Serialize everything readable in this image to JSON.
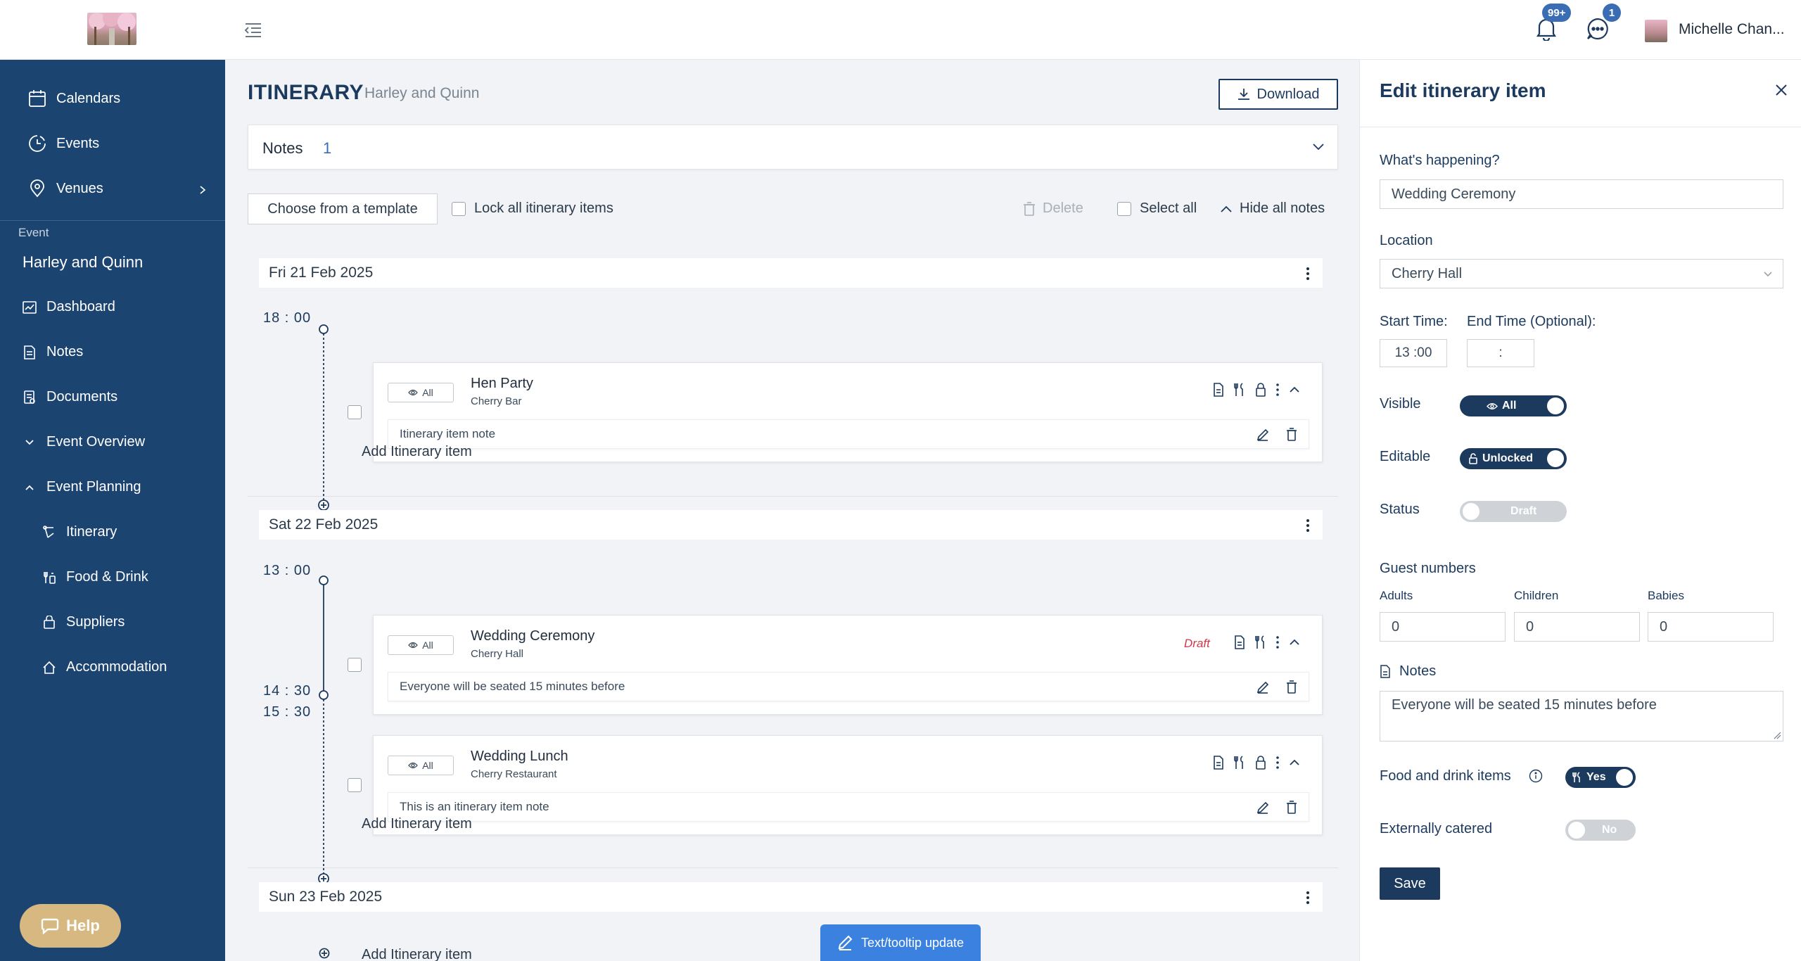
{
  "topbar": {
    "notifications_badge": "99+",
    "messages_badge": "1",
    "user_name": "Michelle Chan..."
  },
  "sidebar": {
    "items": [
      {
        "label": "Calendars",
        "icon": "calendar-icon"
      },
      {
        "label": "Events",
        "icon": "events-icon"
      },
      {
        "label": "Venues",
        "icon": "location-pin-icon"
      }
    ],
    "event_section_label": "Event",
    "event_name": "Harley and Quinn",
    "event_items": [
      {
        "label": "Dashboard",
        "icon": "dashboard-icon"
      },
      {
        "label": "Notes",
        "icon": "note-icon"
      },
      {
        "label": "Documents",
        "icon": "documents-icon"
      },
      {
        "label": "Event Overview",
        "icon": "chevron-down-icon"
      },
      {
        "label": "Event Planning",
        "icon": "chevron-up-icon"
      }
    ],
    "planning_items": [
      {
        "label": "Itinerary",
        "icon": "itinerary-icon"
      },
      {
        "label": "Food & Drink",
        "icon": "food-drink-icon"
      },
      {
        "label": "Suppliers",
        "icon": "suppliers-icon"
      },
      {
        "label": "Accommodation",
        "icon": "home-icon"
      }
    ],
    "help_label": "Help"
  },
  "main": {
    "title": "ITINERARY",
    "subtitle": "Harley and Quinn",
    "download_label": "Download",
    "notes_label": "Notes",
    "notes_count": "1",
    "template_label": "Choose from a template",
    "lock_all_label": "Lock all itinerary items",
    "delete_label": "Delete",
    "select_all_label": "Select all",
    "hide_notes_label": "Hide all notes",
    "add_item_label": "Add Itinerary item",
    "days": [
      {
        "date": "Fri 21 Feb 2025",
        "items": [
          {
            "start": "18 : 00",
            "visibility": "All",
            "title": "Hen Party",
            "location": "Cherry Bar",
            "note": "Itinerary item note"
          }
        ]
      },
      {
        "date": "Sat 22 Feb 2025",
        "items": [
          {
            "start": "13 : 00",
            "visibility": "All",
            "title": "Wedding Ceremony",
            "location": "Cherry Hall",
            "status": "Draft",
            "note": "Everyone will be seated 15 minutes before"
          },
          {
            "start": "14 : 30",
            "end": "15 : 30",
            "visibility": "All",
            "title": "Wedding Lunch",
            "location": "Cherry Restaurant",
            "note": "This is an itinerary item note"
          }
        ]
      },
      {
        "date": "Sun 23 Feb 2025",
        "items": []
      }
    ],
    "update_banner": "Text/tooltip update"
  },
  "panel": {
    "title": "Edit itinerary item",
    "whats_happening_label": "What's happening?",
    "whats_happening_value": "Wedding Ceremony",
    "location_label": "Location",
    "location_value": "Cherry Hall",
    "start_time_label": "Start Time:",
    "end_time_label": "End Time (Optional):",
    "start_time_value": "13 :00",
    "end_time_value": ":",
    "visible_label": "Visible",
    "visible_value": "All",
    "editable_label": "Editable",
    "editable_value": "Unlocked",
    "status_label": "Status",
    "status_value": "Draft",
    "guest_numbers_label": "Guest numbers",
    "adults_label": "Adults",
    "adults_value": "0",
    "children_label": "Children",
    "children_value": "0",
    "babies_label": "Babies",
    "babies_value": "0",
    "notes_label": "Notes",
    "notes_value": "Everyone will be seated 15 minutes before",
    "food_label": "Food and drink items",
    "food_value": "Yes",
    "catered_label": "Externally catered",
    "catered_value": "No",
    "save_label": "Save"
  },
  "colors": {
    "sidebar_bg": "#1c4470",
    "primary": "#1c3a5e",
    "badge": "#3a6db3",
    "help_button": "#d6b880",
    "draft_text": "#d2394a",
    "banner": "#3b82e0"
  }
}
